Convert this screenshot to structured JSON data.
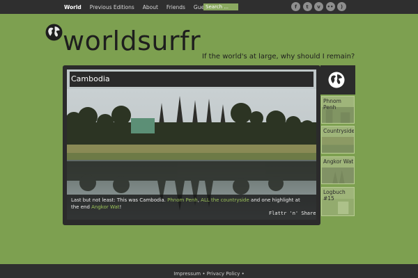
{
  "nav": {
    "items": [
      "World",
      "Previous Editions",
      "About",
      "Friends",
      "Guestbook"
    ],
    "active_index": 0
  },
  "search": {
    "placeholder": "Search ..."
  },
  "social": [
    {
      "icon": "facebook-icon",
      "glyph": "f"
    },
    {
      "icon": "twitter-icon",
      "glyph": "t"
    },
    {
      "icon": "vimeo-icon",
      "glyph": "v"
    },
    {
      "icon": "flickr-icon",
      "glyph": "••"
    },
    {
      "icon": "rss-icon",
      "glyph": ")"
    }
  ],
  "header": {
    "title": "worldsurfr",
    "tagline": "If the world's at large, why should I remain?"
  },
  "slide": {
    "title": "Cambodia",
    "caption_pre": "Last but not least: This was Cambodia. ",
    "link1": "Phnom Penh",
    "caption_mid1": ", ",
    "link2": "ALL the countryside",
    "caption_mid2": " and one highlight at the end ",
    "link3": "Angkor Wat",
    "caption_post": "!",
    "flattr": "Flattr 'n' Share"
  },
  "thumbs": [
    "Phnom Penh",
    "Countryside",
    "Angkor Wat",
    "Logbuch #15"
  ],
  "footer": {
    "links": [
      "Impressum",
      "Privacy Policy"
    ],
    "separator": "•"
  },
  "colors": {
    "background": "#7da050",
    "bars": "#2f2f2f",
    "link": "#9cc35a"
  }
}
